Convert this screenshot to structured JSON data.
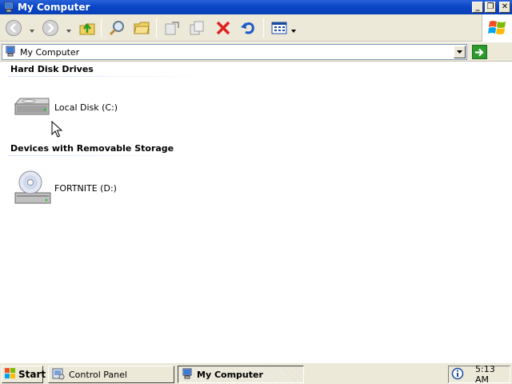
{
  "window": {
    "title": "My Computer",
    "buttons": {
      "minimize": "_",
      "restore": "❐",
      "close": "✕"
    }
  },
  "toolbar": {
    "buttons": [
      {
        "name": "back-button",
        "icon": "back-arrow-icon"
      },
      {
        "name": "forward-button",
        "icon": "forward-arrow-icon"
      },
      {
        "name": "up-button",
        "icon": "folder-up-icon"
      },
      {
        "name": "search-button",
        "icon": "magnifier-icon"
      },
      {
        "name": "folders-button",
        "icon": "folder-icon"
      },
      {
        "name": "move-to-button",
        "icon": "move-to-icon"
      },
      {
        "name": "copy-to-button",
        "icon": "copy-to-icon"
      },
      {
        "name": "delete-button",
        "icon": "red-x-icon"
      },
      {
        "name": "undo-button",
        "icon": "undo-arrow-icon"
      },
      {
        "name": "views-button",
        "icon": "views-grid-icon"
      }
    ]
  },
  "address": {
    "value": "My Computer",
    "icon": "computer-icon",
    "go_icon": "green-arrow-icon"
  },
  "content": {
    "groups": [
      {
        "header": "Hard Disk Drives",
        "items": [
          {
            "label": "Local Disk (C:)",
            "icon": "hard-disk-icon"
          }
        ]
      },
      {
        "header": "Devices with Removable Storage",
        "items": [
          {
            "label": "FORTNITE (D:)",
            "icon": "cd-drive-icon"
          }
        ]
      }
    ]
  },
  "taskbar": {
    "start_label": "Start",
    "tasks": [
      {
        "label": "Control Panel",
        "active": false
      },
      {
        "label": "My Computer",
        "active": true
      }
    ],
    "clock": "5:13 AM"
  },
  "colors": {
    "titlebar": "#0a46c6",
    "chrome": "#ece9d8",
    "delete_red": "#e02020",
    "go_green": "#2c9a2c"
  }
}
